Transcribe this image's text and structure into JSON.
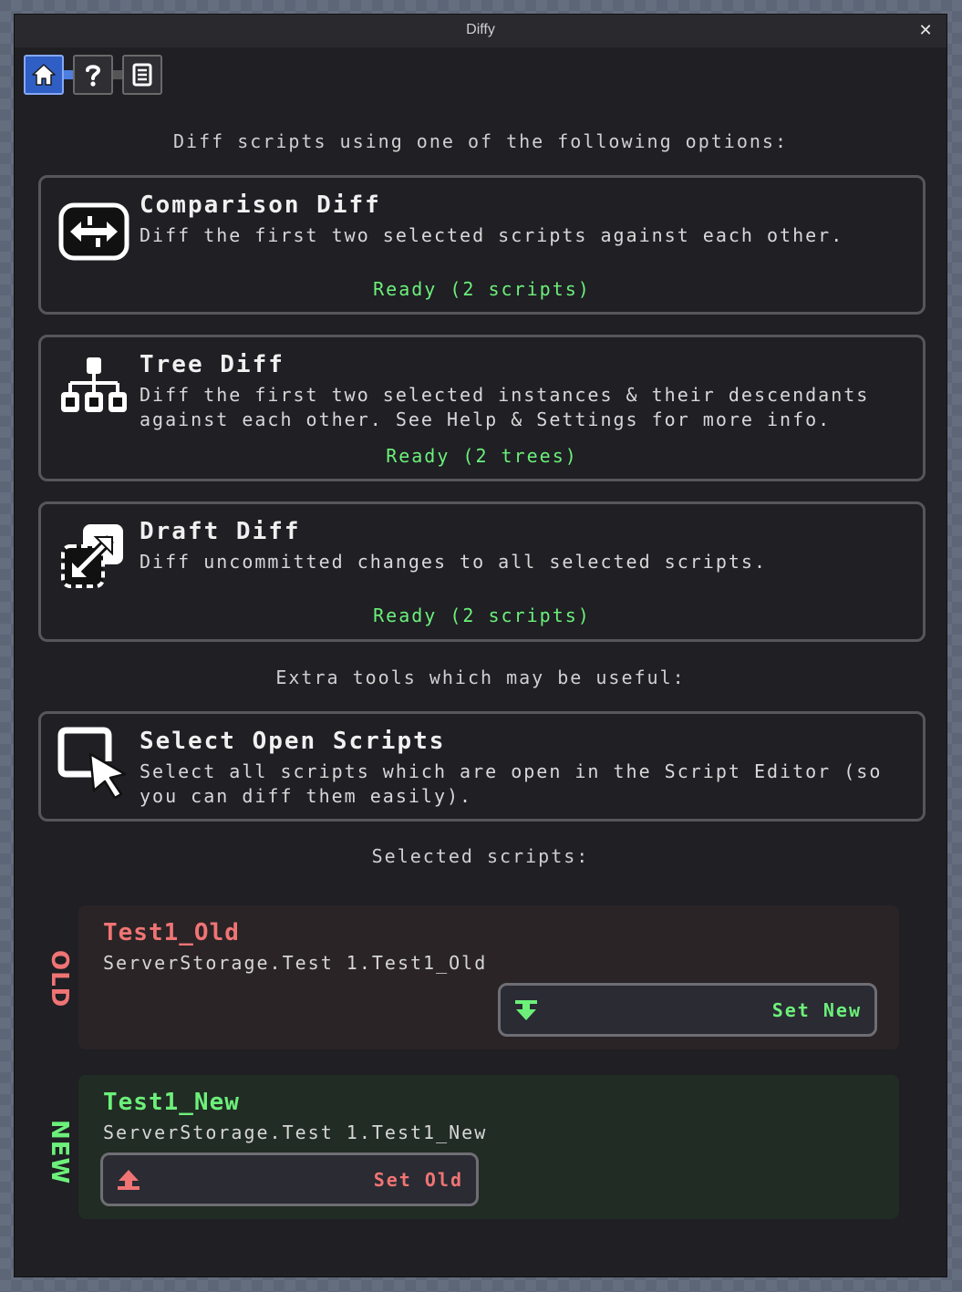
{
  "window": {
    "title": "Diffy",
    "close_label": "✕"
  },
  "toolbar": {
    "items": [
      "home",
      "help",
      "changelog"
    ],
    "active": "home"
  },
  "intro_heading": "Diff scripts using one of the following options:",
  "options": [
    {
      "title": "Comparison Diff",
      "description": "Diff the first two selected scripts against each other.",
      "status": "Ready (2 scripts)",
      "icon": "arrows-compare-icon"
    },
    {
      "title": "Tree Diff",
      "description": "Diff the first two selected instances & their descendants against each other. See Help & Settings for more info.",
      "status": "Ready (2 trees)",
      "icon": "hierarchy-tree-icon"
    },
    {
      "title": "Draft Diff",
      "description": "Diff uncommitted changes to all selected scripts.",
      "status": "Ready (2 scripts)",
      "icon": "draft-arrow-icon"
    }
  ],
  "extra_heading": "Extra tools which may be useful:",
  "extra_tools": [
    {
      "title": "Select Open Scripts",
      "description": "Select all scripts which are open in the Script Editor (so you can diff them easily).",
      "icon": "select-cursor-icon"
    }
  ],
  "selected_heading": "Selected scripts:",
  "selected": {
    "old": {
      "side_label": "OLD",
      "name": "Test1_Old",
      "path": "ServerStorage.Test 1.Test1_Old",
      "button_label": "Set New",
      "button_icon": "arrow-down-bar-icon"
    },
    "new": {
      "side_label": "NEW",
      "name": "Test1_New",
      "path": "ServerStorage.Test 1.Test1_New",
      "button_label": "Set Old",
      "button_icon": "arrow-up-bar-icon"
    }
  },
  "colors": {
    "accent_blue": "#2f5fc4",
    "ready_green": "#6cf07a",
    "old_red": "#f07474",
    "new_green": "#6cf07a",
    "old_card_bg": "#2a2426",
    "new_card_bg": "#212c24"
  }
}
